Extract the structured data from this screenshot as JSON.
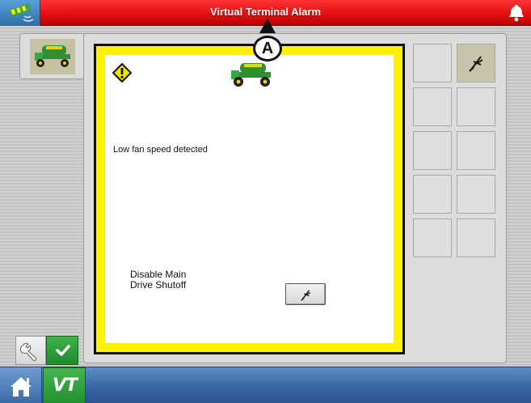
{
  "titlebar": {
    "title": "Virtual Terminal Alarm",
    "color": "#e01010",
    "gps_icon": "gps-status-icon",
    "bell_icon": "alarm-bell-icon"
  },
  "callout": {
    "label": "A"
  },
  "implement_tab": {
    "icon": "sprayer-icon"
  },
  "alarm": {
    "border_color": "#fff100",
    "warning_icon": "warning-diamond-icon",
    "implement_icon": "sprayer-icon",
    "message": "Low fan speed detected",
    "drive_line1": "Disable Main",
    "drive_line2": "Drive Shutoff",
    "action_icon": "drive-shutoff-icon"
  },
  "softkeys": [
    {
      "slot": "1",
      "icon": ""
    },
    {
      "slot": "2",
      "icon": "drive-shutoff-icon"
    },
    {
      "slot": "3",
      "icon": ""
    },
    {
      "slot": "4",
      "icon": ""
    },
    {
      "slot": "5",
      "icon": ""
    },
    {
      "slot": "6",
      "icon": ""
    },
    {
      "slot": "7",
      "icon": ""
    },
    {
      "slot": "8",
      "icon": ""
    },
    {
      "slot": "9",
      "icon": ""
    },
    {
      "slot": "10",
      "icon": ""
    }
  ],
  "tools": {
    "settings_icon": "wrench-icon",
    "accept_icon": "checkmark-icon"
  },
  "navbar": {
    "home_icon": "home-icon",
    "vt_label": "VT"
  }
}
